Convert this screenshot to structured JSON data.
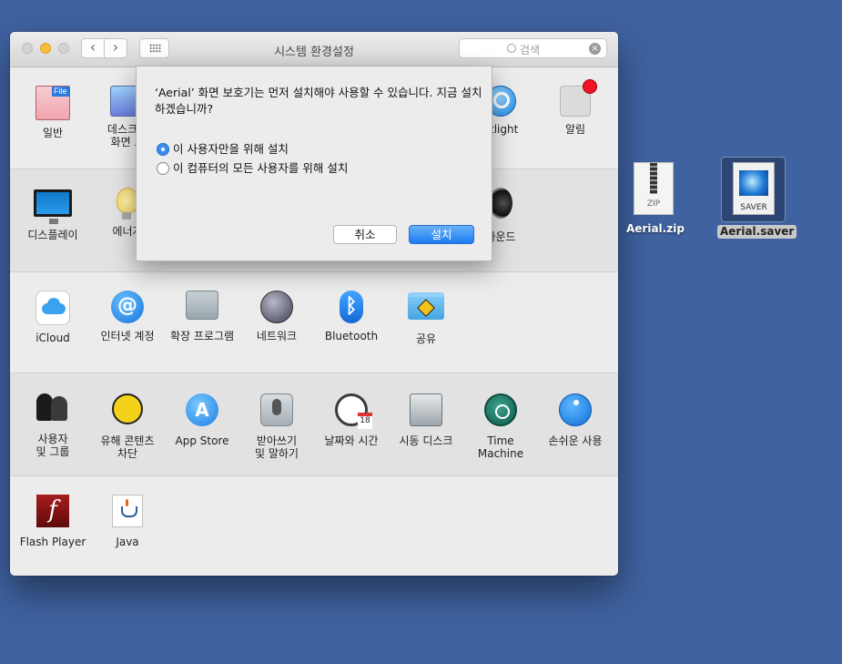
{
  "window": {
    "title": "시스템 환경설정",
    "search_placeholder": "검색"
  },
  "rows": [
    [
      {
        "label": "일반",
        "icon": "general-icon"
      },
      {
        "label": "데스크탑\n화면 보",
        "icon": "desktop-icon"
      },
      {
        "label": "otlight",
        "icon": "spotlight-icon"
      },
      {
        "label": "알림",
        "icon": "notifications-icon"
      }
    ],
    [
      {
        "label": "디스플레이",
        "icon": "display-icon"
      },
      {
        "label": "에너지 ",
        "icon": "energy-icon"
      },
      {
        "label": "사운드",
        "icon": "sound-icon"
      }
    ],
    [
      {
        "label": "iCloud",
        "icon": "icloud-icon"
      },
      {
        "label": "인터넷 계정",
        "icon": "internet-accounts-icon"
      },
      {
        "label": "확장 프로그램",
        "icon": "extensions-icon"
      },
      {
        "label": "네트워크",
        "icon": "network-icon"
      },
      {
        "label": "Bluetooth",
        "icon": "bluetooth-icon"
      },
      {
        "label": "공유",
        "icon": "sharing-icon"
      }
    ],
    [
      {
        "label": "사용자\n및 그룹",
        "icon": "users-icon"
      },
      {
        "label": "유해 콘텐츠\n차단",
        "icon": "parental-controls-icon"
      },
      {
        "label": "App Store",
        "icon": "app-store-icon"
      },
      {
        "label": "받아쓰기\n및 말하기",
        "icon": "dictation-icon"
      },
      {
        "label": "날짜와 시간",
        "icon": "date-time-icon"
      },
      {
        "label": "시동 디스크",
        "icon": "startup-disk-icon"
      },
      {
        "label": "Time Machine",
        "icon": "time-machine-icon"
      },
      {
        "label": "손쉬운 사용",
        "icon": "accessibility-icon"
      }
    ],
    [
      {
        "label": "Flash Player",
        "icon": "flash-icon"
      },
      {
        "label": "Java",
        "icon": "java-icon"
      }
    ]
  ],
  "dialog": {
    "message": "‘Aerial’ 화면 보호기는 먼저 설치해야 사용할 수 있습니다. 지금 설치하겠습니까?",
    "option_user": "이 사용자만을 위해 설치",
    "option_all": "이 컴퓨터의 모든 사용자를 위해 설치",
    "selected": "option_user",
    "cancel": "취소",
    "install": "설치"
  },
  "desktop": {
    "zip_name": "Aerial.zip",
    "zip_badge": "ZIP",
    "saver_name": "Aerial.saver",
    "saver_badge": "SAVER"
  },
  "colors": {
    "desktop_bg": "#3f62a0",
    "accent": "#1b7cf0",
    "minimize": "#f9be38"
  }
}
